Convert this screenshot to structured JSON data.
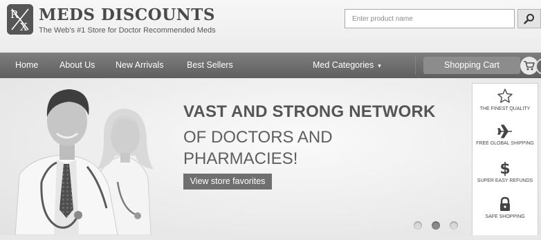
{
  "brand": {
    "logo_letter_top": "R",
    "logo_letter_bottom": "X",
    "name": "MEDS DISCOUNTS",
    "tagline": "The Web's #1 Store for Doctor Recommended Meds"
  },
  "search": {
    "placeholder": "Enter product name",
    "icon": "search-icon"
  },
  "nav": {
    "items": [
      {
        "label": "Home"
      },
      {
        "label": "About Us"
      },
      {
        "label": "New Arrivals"
      },
      {
        "label": "Best Sellers"
      }
    ],
    "categories_label": "Med Categories",
    "categories_caret": "▾",
    "cart_label": "Shopping Cart",
    "cart_icon": "cart-icon"
  },
  "hero": {
    "headline": "VAST AND STRONG NETWORK",
    "subline": "OF DOCTORS AND PHARMACIES!",
    "cta_label": "View store favorites",
    "slides": 3,
    "active_slide": 2
  },
  "features": [
    {
      "icon": "star-icon",
      "label": "The finest quality"
    },
    {
      "icon": "airplane-icon",
      "label": "Free global shipping"
    },
    {
      "icon": "dollar-icon",
      "label": "Super easy refunds"
    },
    {
      "icon": "lock-icon",
      "label": "Safe shopping"
    }
  ],
  "colors": {
    "nav_background": "#6e6e6e",
    "cta_background": "#6f6f6f",
    "cart_button": "#8c8c8c"
  }
}
